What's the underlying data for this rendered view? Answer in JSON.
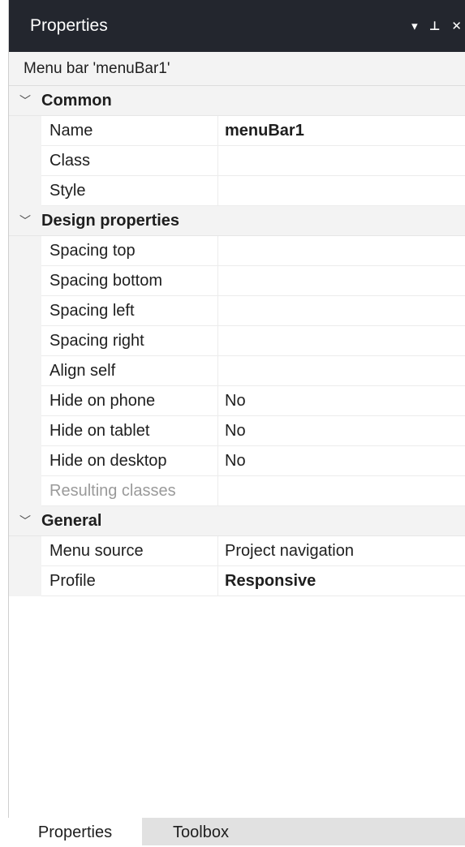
{
  "panel": {
    "title": "Properties",
    "icons": [
      "dropdown-icon",
      "pin-icon",
      "close-icon"
    ],
    "icon_glyphs": {
      "dropdown": "▾",
      "pin": "⊥",
      "close": "✕"
    }
  },
  "selected_object": "Menu bar 'menuBar1'",
  "categories": [
    {
      "label": "Common",
      "rows": [
        {
          "name": "Name",
          "value": "menuBar1"
        },
        {
          "name": "Class",
          "value": ""
        },
        {
          "name": "Style",
          "value": ""
        }
      ]
    },
    {
      "label": "Design properties",
      "rows": [
        {
          "name": "Spacing top",
          "value": ""
        },
        {
          "name": "Spacing bottom",
          "value": ""
        },
        {
          "name": "Spacing left",
          "value": ""
        },
        {
          "name": "Spacing right",
          "value": ""
        },
        {
          "name": "Align self",
          "value": ""
        },
        {
          "name": "Hide on phone",
          "value": "No"
        },
        {
          "name": "Hide on tablet",
          "value": "No"
        },
        {
          "name": "Hide on desktop",
          "value": "No"
        },
        {
          "name": "Resulting classes",
          "value": ""
        }
      ]
    },
    {
      "label": "General",
      "rows": [
        {
          "name": "Menu source",
          "value": "Project navigation"
        },
        {
          "name": "Profile",
          "value": "Responsive"
        }
      ]
    }
  ],
  "tabs": [
    {
      "label": "Properties"
    },
    {
      "label": "Toolbox"
    }
  ],
  "colors": {
    "titlebar_bg": "#23262e",
    "category_bg": "#f3f3f3",
    "tabbar_bg": "#e1e1e1"
  }
}
